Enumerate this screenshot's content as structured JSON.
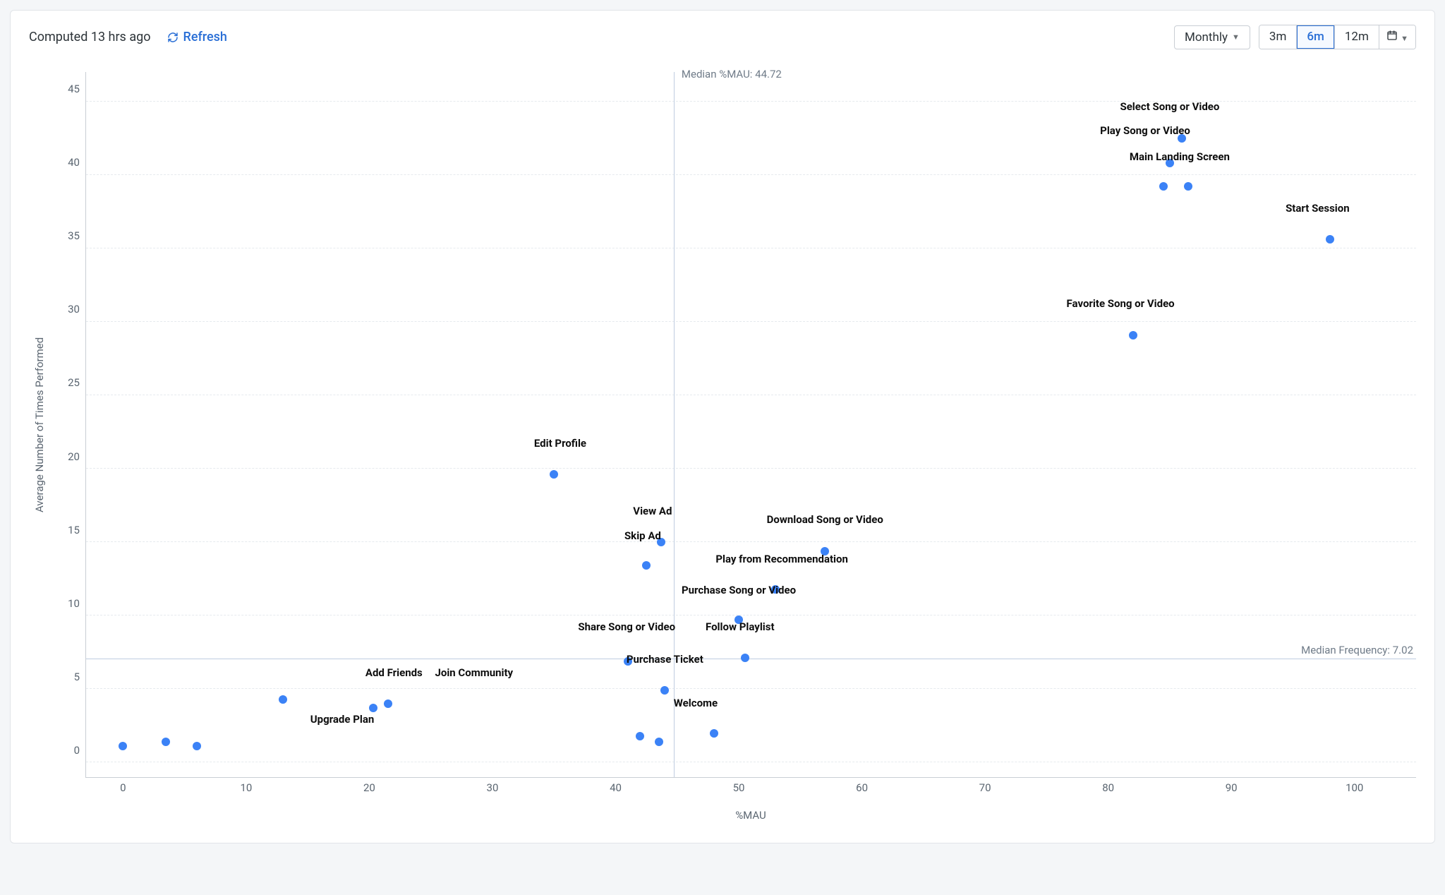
{
  "header": {
    "computed_text": "Computed 13 hrs ago",
    "refresh_label": "Refresh",
    "interval_label": "Monthly",
    "ranges": [
      "3m",
      "6m",
      "12m"
    ],
    "active_range": "6m"
  },
  "chart_data": {
    "type": "scatter",
    "xlabel": "%MAU",
    "ylabel": "Average Number of Times Performed",
    "xlim": [
      -3,
      105
    ],
    "ylim": [
      -1,
      47
    ],
    "xticks": [
      0,
      10,
      20,
      30,
      40,
      50,
      60,
      70,
      80,
      90,
      100
    ],
    "yticks": [
      0,
      5,
      10,
      15,
      20,
      25,
      30,
      35,
      40,
      45
    ],
    "median_x": {
      "value": 44.72,
      "label": "Median %MAU: 44.72"
    },
    "median_y": {
      "value": 7.02,
      "label": "Median Frequency: 7.02"
    },
    "points": [
      {
        "label": "Select Song or Video",
        "x": 86,
        "y": 42.5,
        "lx": 85,
        "ly": 44.2
      },
      {
        "label": "Play Song or Video",
        "x": 85,
        "y": 40.8,
        "lx": 83,
        "ly": 42.6
      },
      {
        "label": "Main Landing Screen",
        "x": 86.5,
        "y": 39.2,
        "lx": 85.8,
        "ly": 40.8
      },
      {
        "label": "",
        "x": 84.5,
        "y": 39.2
      },
      {
        "label": "Start Session",
        "x": 98,
        "y": 35.6,
        "lx": 97,
        "ly": 37.3
      },
      {
        "label": "Favorite Song or Video",
        "x": 82,
        "y": 29.1,
        "lx": 81,
        "ly": 30.8
      },
      {
        "label": "Edit Profile",
        "x": 35,
        "y": 19.6,
        "lx": 35.5,
        "ly": 21.3
      },
      {
        "label": "View Ad",
        "x": 43.7,
        "y": 15,
        "lx": 43,
        "ly": 16.7
      },
      {
        "label": "Download Song or Video",
        "x": 57,
        "y": 14.4,
        "lx": 57.0,
        "ly": 16.1
      },
      {
        "label": "Skip Ad",
        "x": 42.5,
        "y": 13.4,
        "lx": 42.2,
        "ly": 15.0
      },
      {
        "label": "Play from Recommendation",
        "x": 53,
        "y": 11.8,
        "lx": 53.5,
        "ly": 13.4
      },
      {
        "label": "Purchase Song or Video",
        "x": 50,
        "y": 9.7,
        "lx": 50.0,
        "ly": 11.3
      },
      {
        "label": "Follow Playlist",
        "x": 50.5,
        "y": 7.1,
        "lx": 50.1,
        "ly": 8.8
      },
      {
        "label": "Share Song or Video",
        "x": 41,
        "y": 6.9,
        "lx": 40.9,
        "ly": 8.8
      },
      {
        "label": "Purchase Ticket",
        "x": 44,
        "y": 4.9,
        "lx": 44.0,
        "ly": 6.6
      },
      {
        "label": "Add Friends",
        "x": 13,
        "y": 4.3,
        "lx": 22.0,
        "ly": 5.7
      },
      {
        "label": "Join Community",
        "x": 21.5,
        "y": 4.0,
        "lx": 28.5,
        "ly": 5.7
      },
      {
        "label": "",
        "x": 20.3,
        "y": 3.7
      },
      {
        "label": "Welcome",
        "x": 48,
        "y": 2.0,
        "lx": 46.5,
        "ly": 3.6
      },
      {
        "label": "",
        "x": 42,
        "y": 1.8
      },
      {
        "label": "",
        "x": 43.5,
        "y": 1.4
      },
      {
        "label": "Upgrade Plan",
        "x": 6,
        "y": 1.1,
        "lx": 17.8,
        "ly": 2.5
      },
      {
        "label": "",
        "x": 3.5,
        "y": 1.4
      },
      {
        "label": "",
        "x": 0,
        "y": 1.1
      }
    ]
  }
}
